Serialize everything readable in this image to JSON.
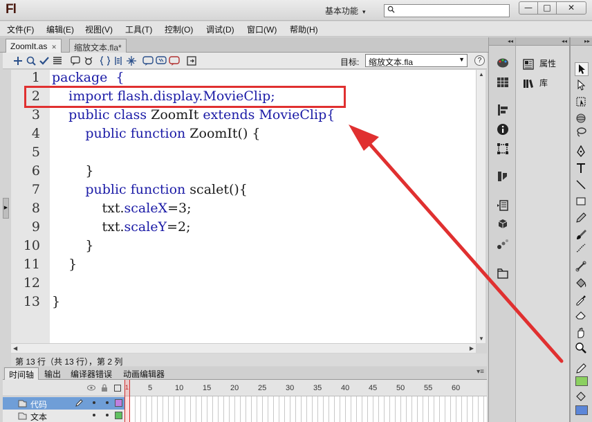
{
  "app": {
    "logo": "Fl",
    "workspace_label": "基本功能",
    "search_placeholder": ""
  },
  "window_buttons": {
    "minimize": "—",
    "maximize": "□",
    "close": "✕"
  },
  "menu": [
    "文件(F)",
    "编辑(E)",
    "视图(V)",
    "工具(T)",
    "控制(O)",
    "调试(D)",
    "窗口(W)",
    "帮助(H)"
  ],
  "doc_tabs": [
    {
      "label": "ZoomIt.as",
      "active": true
    },
    {
      "label": "缩放文本.fla*",
      "active": false
    }
  ],
  "toolbar": {
    "icons": [
      "add-item-icon",
      "find-icon",
      "check-syntax-icon",
      "auto-format-icon",
      "code-hint-icon",
      "debug-options-icon",
      "collapse-braces-icon",
      "collapse-selection-icon",
      "expand-all-icon",
      "block-comment-icon",
      "line-comment-icon",
      "remove-comment-icon",
      "toggle-toolbox-icon"
    ],
    "target_label": "目标:",
    "target_value": "缩放文本.fla"
  },
  "editor": {
    "lines": [
      {
        "num": "1",
        "parts": [
          {
            "t": "package  {",
            "kw": true
          }
        ]
      },
      {
        "num": "2",
        "parts": [
          {
            "t": "    import flash.display.MovieClip;",
            "kw": true
          }
        ]
      },
      {
        "num": "3",
        "parts": [
          {
            "t": "    public class ",
            "kw": true
          },
          {
            "t": "ZoomIt ",
            "kw": false
          },
          {
            "t": "extends MovieClip{",
            "kw": true
          }
        ]
      },
      {
        "num": "4",
        "parts": [
          {
            "t": "        public function ",
            "kw": true
          },
          {
            "t": "ZoomIt() {",
            "kw": false
          }
        ]
      },
      {
        "num": "5",
        "parts": [
          {
            "t": "",
            "kw": false
          }
        ]
      },
      {
        "num": "6",
        "parts": [
          {
            "t": "        }",
            "kw": false
          }
        ]
      },
      {
        "num": "7",
        "parts": [
          {
            "t": "        public function ",
            "kw": true
          },
          {
            "t": "scalet(){",
            "kw": false
          }
        ]
      },
      {
        "num": "8",
        "parts": [
          {
            "t": "            txt.",
            "kw": false
          },
          {
            "t": "scaleX",
            "kw": true
          },
          {
            "t": "=3;",
            "kw": false
          }
        ]
      },
      {
        "num": "9",
        "parts": [
          {
            "t": "            txt.",
            "kw": false
          },
          {
            "t": "scaleY",
            "kw": true
          },
          {
            "t": "=2;",
            "kw": false
          }
        ]
      },
      {
        "num": "10",
        "parts": [
          {
            "t": "        }",
            "kw": false
          }
        ]
      },
      {
        "num": "11",
        "parts": [
          {
            "t": "    }",
            "kw": false
          }
        ]
      },
      {
        "num": "12",
        "parts": [
          {
            "t": "",
            "kw": false
          }
        ]
      },
      {
        "num": "13",
        "parts": [
          {
            "t": "}",
            "kw": false
          }
        ]
      }
    ]
  },
  "status": "第 13 行（共 13 行），第 2 列",
  "timeline": {
    "tabs": [
      "时间轴",
      "输出",
      "编译器错误",
      "动画编辑器"
    ],
    "frame_numbers": [
      "1",
      "5",
      "10",
      "15",
      "20",
      "25",
      "30",
      "35",
      "40",
      "45",
      "50",
      "55",
      "60"
    ],
    "layers": [
      {
        "name": "代码",
        "selected": true,
        "color": "#c080e0"
      },
      {
        "name": "文本",
        "selected": false,
        "color": "#60c060"
      }
    ]
  },
  "panels": {
    "properties_label": "属性",
    "library_label": "库"
  },
  "colors": {
    "keyword": "#1a1aa6",
    "highlight": "#e03030",
    "stroke_swatch": "#8bd060",
    "fill_swatch": "#5c86d8"
  }
}
